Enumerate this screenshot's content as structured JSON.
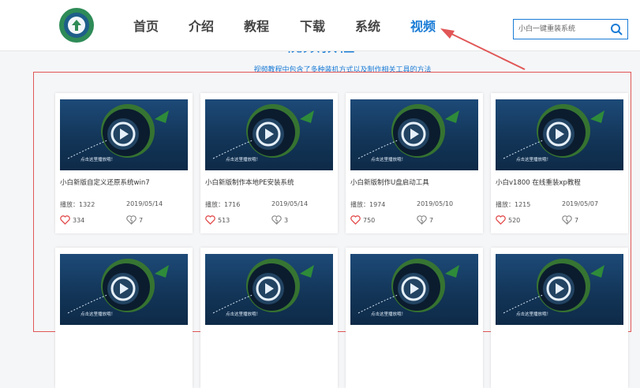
{
  "nav": {
    "items": [
      "首页",
      "介绍",
      "教程",
      "下载",
      "系统",
      "视频"
    ],
    "active_index": 5
  },
  "search": {
    "placeholder": "小白一键重装系统"
  },
  "section": {
    "title": "视频教程",
    "subtitle": "视频教程中包含了多种装机方式以及制作相关工具的方法"
  },
  "colors": {
    "accent": "#1a7cd6",
    "annotation": "#e15656",
    "like": "#e24b4b"
  },
  "thumb_caption": "点击这里播放哦！",
  "cards": [
    {
      "title": "小白新版自定义还原系统win7",
      "plays_label": "播放：1322",
      "date": "2019/05/14",
      "likes": "334",
      "comments": "7"
    },
    {
      "title": "小白新版制作本地PE安装系统",
      "plays_label": "播放：1716",
      "date": "2019/05/14",
      "likes": "513",
      "comments": "3"
    },
    {
      "title": "小白新版制作U盘启动工具",
      "plays_label": "播放：1974",
      "date": "2019/05/10",
      "likes": "750",
      "comments": "7"
    },
    {
      "title": "小白v1800 在线重装xp教程",
      "plays_label": "播放：1215",
      "date": "2019/05/07",
      "likes": "520",
      "comments": "7"
    }
  ]
}
